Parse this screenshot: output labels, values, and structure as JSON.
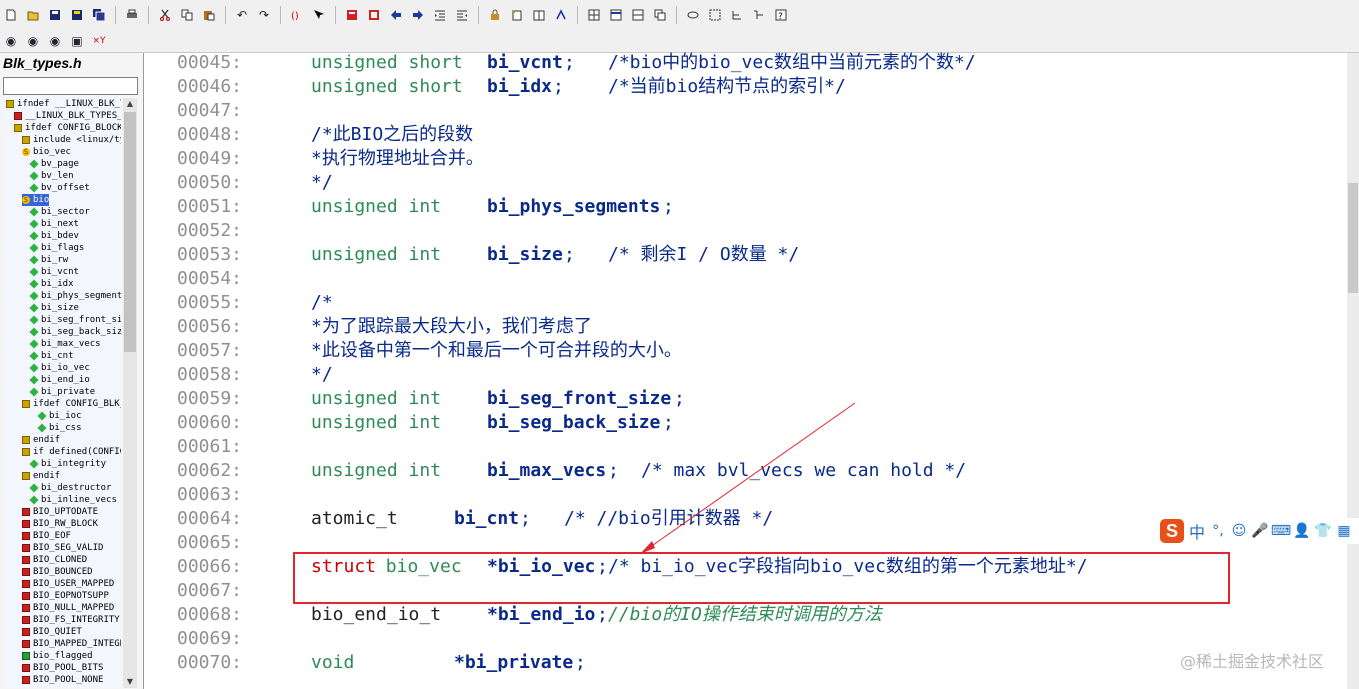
{
  "sidebar": {
    "file_title": "Blk_types.h",
    "tree": [
      {
        "indent": 0,
        "icon": "hash",
        "label": "ifndef __LINUX_BLK_TYPES_H"
      },
      {
        "indent": 1,
        "icon": "red",
        "label": "__LINUX_BLK_TYPES_H"
      },
      {
        "indent": 1,
        "icon": "hash",
        "label": "ifdef CONFIG_BLOCK"
      },
      {
        "indent": 2,
        "icon": "hash",
        "label": "include <linux/types.h>"
      },
      {
        "indent": 2,
        "icon": "s",
        "label": "bio_vec"
      },
      {
        "indent": 3,
        "icon": "diamond",
        "label": "bv_page"
      },
      {
        "indent": 3,
        "icon": "diamond",
        "label": "bv_len"
      },
      {
        "indent": 3,
        "icon": "diamond",
        "label": "bv_offset"
      },
      {
        "indent": 2,
        "icon": "s",
        "label": "bio",
        "selected": true
      },
      {
        "indent": 3,
        "icon": "diamond",
        "label": "bi_sector"
      },
      {
        "indent": 3,
        "icon": "diamond",
        "label": "bi_next"
      },
      {
        "indent": 3,
        "icon": "diamond",
        "label": "bi_bdev"
      },
      {
        "indent": 3,
        "icon": "diamond",
        "label": "bi_flags"
      },
      {
        "indent": 3,
        "icon": "diamond",
        "label": "bi_rw"
      },
      {
        "indent": 3,
        "icon": "diamond",
        "label": "bi_vcnt"
      },
      {
        "indent": 3,
        "icon": "diamond",
        "label": "bi_idx"
      },
      {
        "indent": 3,
        "icon": "diamond",
        "label": "bi_phys_segments"
      },
      {
        "indent": 3,
        "icon": "diamond",
        "label": "bi_size"
      },
      {
        "indent": 3,
        "icon": "diamond",
        "label": "bi_seg_front_size"
      },
      {
        "indent": 3,
        "icon": "diamond",
        "label": "bi_seg_back_size"
      },
      {
        "indent": 3,
        "icon": "diamond",
        "label": "bi_max_vecs"
      },
      {
        "indent": 3,
        "icon": "diamond",
        "label": "bi_cnt"
      },
      {
        "indent": 3,
        "icon": "diamond",
        "label": "bi_io_vec"
      },
      {
        "indent": 3,
        "icon": "diamond",
        "label": "bi_end_io"
      },
      {
        "indent": 3,
        "icon": "diamond",
        "label": "bi_private"
      },
      {
        "indent": 2,
        "icon": "hash",
        "label": "ifdef CONFIG_BLK_CGROUP"
      },
      {
        "indent": 4,
        "icon": "diamond",
        "label": "bi_ioc"
      },
      {
        "indent": 4,
        "icon": "diamond",
        "label": "bi_css"
      },
      {
        "indent": 2,
        "icon": "hash",
        "label": "endif"
      },
      {
        "indent": 2,
        "icon": "hash",
        "label": "if defined(CONFIG_BLK_DEV_INTEGRITY)"
      },
      {
        "indent": 3,
        "icon": "diamond",
        "label": "bi_integrity"
      },
      {
        "indent": 2,
        "icon": "hash",
        "label": "endif"
      },
      {
        "indent": 3,
        "icon": "diamond",
        "label": "bi_destructor"
      },
      {
        "indent": 3,
        "icon": "diamond",
        "label": "bi_inline_vecs"
      },
      {
        "indent": 2,
        "icon": "red",
        "label": "BIO_UPTODATE"
      },
      {
        "indent": 2,
        "icon": "red",
        "label": "BIO_RW_BLOCK"
      },
      {
        "indent": 2,
        "icon": "red",
        "label": "BIO_EOF"
      },
      {
        "indent": 2,
        "icon": "red",
        "label": "BIO_SEG_VALID"
      },
      {
        "indent": 2,
        "icon": "red",
        "label": "BIO_CLONED"
      },
      {
        "indent": 2,
        "icon": "red",
        "label": "BIO_BOUNCED"
      },
      {
        "indent": 2,
        "icon": "red",
        "label": "BIO_USER_MAPPED"
      },
      {
        "indent": 2,
        "icon": "red",
        "label": "BIO_EOPNOTSUPP"
      },
      {
        "indent": 2,
        "icon": "red",
        "label": "BIO_NULL_MAPPED"
      },
      {
        "indent": 2,
        "icon": "red",
        "label": "BIO_FS_INTEGRITY"
      },
      {
        "indent": 2,
        "icon": "red",
        "label": "BIO_QUIET"
      },
      {
        "indent": 2,
        "icon": "red",
        "label": "BIO_MAPPED_INTEGRITY"
      },
      {
        "indent": 2,
        "icon": "green",
        "label": "bio_flagged"
      },
      {
        "indent": 2,
        "icon": "red",
        "label": "BIO_POOL_BITS"
      },
      {
        "indent": 2,
        "icon": "red",
        "label": "BIO_POOL_NONE"
      }
    ]
  },
  "code": [
    {
      "ln": "00045:",
      "tokens": [
        {
          "c": "ty",
          "t": "unsigned short",
          "col": 0
        },
        {
          "c": "id",
          "t": "bi_vcnt",
          "col": 16
        },
        {
          "c": "cm",
          "t": ";",
          "col": 23
        },
        {
          "c": "cm",
          "t": "/*bio中的bio_vec数组中当前元素的个数*/",
          "col": 27
        }
      ]
    },
    {
      "ln": "00046:",
      "tokens": [
        {
          "c": "ty",
          "t": "unsigned short",
          "col": 0
        },
        {
          "c": "id",
          "t": "bi_idx",
          "col": 16
        },
        {
          "c": "cm",
          "t": ";",
          "col": 22
        },
        {
          "c": "cm",
          "t": "/*当前bio结构节点的索引*/",
          "col": 27
        }
      ]
    },
    {
      "ln": "00047:",
      "tokens": []
    },
    {
      "ln": "00048:",
      "tokens": [
        {
          "c": "cm",
          "t": "/*此BIO之后的段数",
          "col": 0
        }
      ]
    },
    {
      "ln": "00049:",
      "tokens": [
        {
          "c": "cm",
          "t": "*执行物理地址合并。",
          "col": 0
        }
      ]
    },
    {
      "ln": "00050:",
      "tokens": [
        {
          "c": "cm",
          "t": "*/",
          "col": 0
        }
      ]
    },
    {
      "ln": "00051:",
      "tokens": [
        {
          "c": "ty",
          "t": "unsigned int",
          "col": 0
        },
        {
          "c": "id",
          "t": "bi_phys_segments",
          "col": 16
        },
        {
          "c": "cm",
          "t": ";",
          "col": 32
        }
      ]
    },
    {
      "ln": "00052:",
      "tokens": []
    },
    {
      "ln": "00053:",
      "tokens": [
        {
          "c": "ty",
          "t": "unsigned int",
          "col": 0
        },
        {
          "c": "id",
          "t": "bi_size",
          "col": 16
        },
        {
          "c": "cm",
          "t": ";",
          "col": 23
        },
        {
          "c": "cm",
          "t": "/* 剩余I / O数量 */",
          "col": 27
        }
      ]
    },
    {
      "ln": "00054:",
      "tokens": []
    },
    {
      "ln": "00055:",
      "tokens": [
        {
          "c": "cm",
          "t": "/*",
          "col": 0
        }
      ]
    },
    {
      "ln": "00056:",
      "tokens": [
        {
          "c": "cm",
          "t": "*为了跟踪最大段大小，我们考虑了",
          "col": 0
        }
      ]
    },
    {
      "ln": "00057:",
      "tokens": [
        {
          "c": "cm",
          "t": "*此设备中第一个和最后一个可合并段的大小。",
          "col": 0
        }
      ]
    },
    {
      "ln": "00058:",
      "tokens": [
        {
          "c": "cm",
          "t": "*/",
          "col": 0
        }
      ]
    },
    {
      "ln": "00059:",
      "tokens": [
        {
          "c": "ty",
          "t": "unsigned int",
          "col": 0
        },
        {
          "c": "id",
          "t": "bi_seg_front_size",
          "col": 16
        },
        {
          "c": "cm",
          "t": ";",
          "col": 33
        }
      ]
    },
    {
      "ln": "00060:",
      "tokens": [
        {
          "c": "ty",
          "t": "unsigned int",
          "col": 0
        },
        {
          "c": "id",
          "t": "bi_seg_back_size",
          "col": 16
        },
        {
          "c": "cm",
          "t": ";",
          "col": 32
        }
      ]
    },
    {
      "ln": "00061:",
      "tokens": []
    },
    {
      "ln": "00062:",
      "tokens": [
        {
          "c": "ty",
          "t": "unsigned int",
          "col": 0
        },
        {
          "c": "id",
          "t": "bi_max_vecs",
          "col": 16
        },
        {
          "c": "cm",
          "t": ";",
          "col": 27
        },
        {
          "c": "cm",
          "t": "/* max bvl_vecs we can hold */",
          "col": 30
        }
      ]
    },
    {
      "ln": "00063:",
      "tokens": []
    },
    {
      "ln": "00064:",
      "tokens": [
        {
          "c": "pl",
          "t": "atomic_t",
          "col": 0
        },
        {
          "c": "id",
          "t": "bi_cnt",
          "col": 13
        },
        {
          "c": "cm",
          "t": ";",
          "col": 19
        },
        {
          "c": "cm",
          "t": "/* //bio引用计数器 */",
          "col": 23
        }
      ]
    },
    {
      "ln": "00065:",
      "tokens": []
    },
    {
      "ln": "00066:",
      "tokens": [
        {
          "c": "kw",
          "t": "struct",
          "col": 0
        },
        {
          "c": "ty",
          "t": "bio_vec",
          "col": 6.8
        },
        {
          "c": "id",
          "t": "*bi_io_vec",
          "col": 16
        },
        {
          "c": "cm",
          "t": ";",
          "col": 26
        },
        {
          "c": "cm",
          "t": "/* bi_io_vec字段指向bio_vec数组的第一个元素地址*/",
          "col": 27
        }
      ]
    },
    {
      "ln": "00067:",
      "tokens": []
    },
    {
      "ln": "00068:",
      "tokens": [
        {
          "c": "pl",
          "t": "bio_end_io_t",
          "col": 0
        },
        {
          "c": "id",
          "t": "*bi_end_io",
          "col": 16
        },
        {
          "c": "cm",
          "t": ";",
          "col": 26
        },
        {
          "c": "cmi",
          "t": "//bio的IO操作结束时调用的方法",
          "col": 27
        }
      ]
    },
    {
      "ln": "00069:",
      "tokens": []
    },
    {
      "ln": "00070:",
      "tokens": [
        {
          "c": "ty",
          "t": "void",
          "col": 0
        },
        {
          "c": "id",
          "t": "*bi_private",
          "col": 13
        },
        {
          "c": "cm",
          "t": ";",
          "col": 24
        }
      ]
    }
  ],
  "ime": {
    "logo": "S",
    "mode": "中"
  },
  "watermark": "@稀土掘金技术社区",
  "colors": {
    "annotation_red": "#e2262f",
    "type_green": "#2e8b57",
    "identifier_navy": "#0a2a8a",
    "keyword_red": "#c80000",
    "selection_blue": "#3565d6"
  }
}
